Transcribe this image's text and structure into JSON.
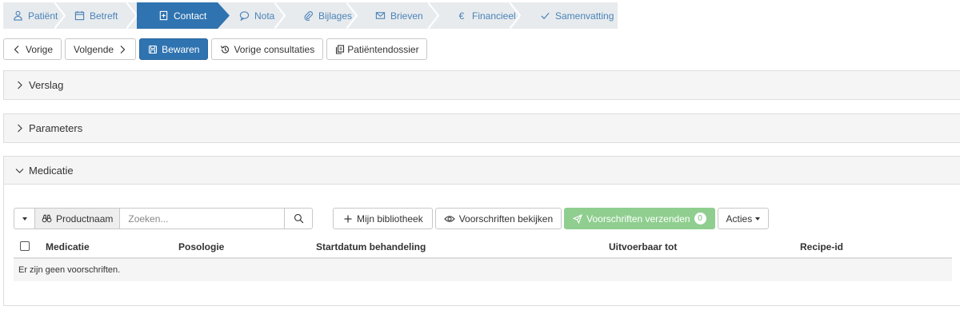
{
  "steps": [
    {
      "label": "Patiënt",
      "icon": "user-icon"
    },
    {
      "label": "Betreft",
      "icon": "calendar-icon"
    },
    {
      "label": "Contact",
      "icon": "medical-file-icon",
      "active": true
    },
    {
      "label": "Nota",
      "icon": "comment-icon"
    },
    {
      "label": "Bijlages",
      "icon": "paperclip-icon"
    },
    {
      "label": "Brieven",
      "icon": "envelope-icon"
    },
    {
      "label": "Financieel",
      "icon": "euro-icon"
    },
    {
      "label": "Samenvatting",
      "icon": "check-icon"
    }
  ],
  "toolbar": {
    "prev_label": "Vorige",
    "next_label": "Volgende",
    "save_label": "Bewaren",
    "history_label": "Vorige consultaties",
    "dossier_label": "Patiëntendossier"
  },
  "panels": {
    "verslag": "Verslag",
    "parameters": "Parameters",
    "medicatie": "Medicatie"
  },
  "medicatie": {
    "search_field": "Productnaam",
    "search_placeholder": "Zoeken...",
    "library_label": "Mijn bibliotheek",
    "view_label": "Voorschriften bekijken",
    "send_label": "Voorschriften verzenden",
    "send_count": "0",
    "actions_label": "Acties",
    "columns": [
      "Medicatie",
      "Posologie",
      "Startdatum behandeling",
      "Uitvoerbaar tot",
      "Recipe-id"
    ],
    "empty_text": "Er zijn geen voorschriften."
  },
  "colors": {
    "primary": "#2f73b0",
    "step_bg": "#e8ebee",
    "step_text": "#4a83b8",
    "success": "#8fce8f"
  }
}
